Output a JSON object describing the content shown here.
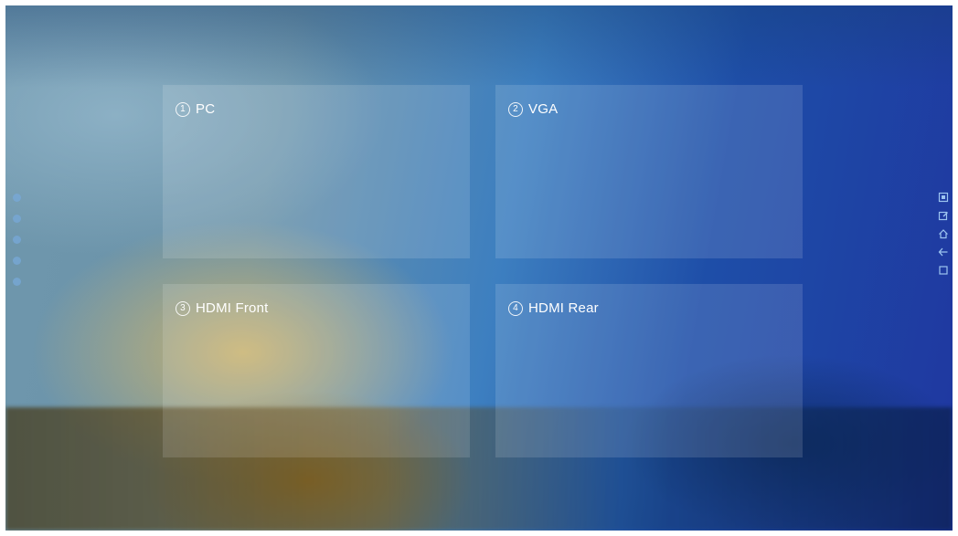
{
  "sources": [
    {
      "number": "1",
      "label": "PC"
    },
    {
      "number": "2",
      "label": "VGA"
    },
    {
      "number": "3",
      "label": "HDMI Front"
    },
    {
      "number": "4",
      "label": "HDMI Rear"
    }
  ],
  "left_indicators": [
    "dot",
    "dot",
    "dot",
    "dot",
    "dot"
  ],
  "right_toolbar": {
    "icons": [
      "screenshot-icon",
      "edit-icon",
      "home-icon",
      "back-icon",
      "recent-apps-icon"
    ]
  },
  "colors": {
    "tile_overlay": "rgba(255,255,255,0.13)",
    "text": "#ffffff"
  }
}
